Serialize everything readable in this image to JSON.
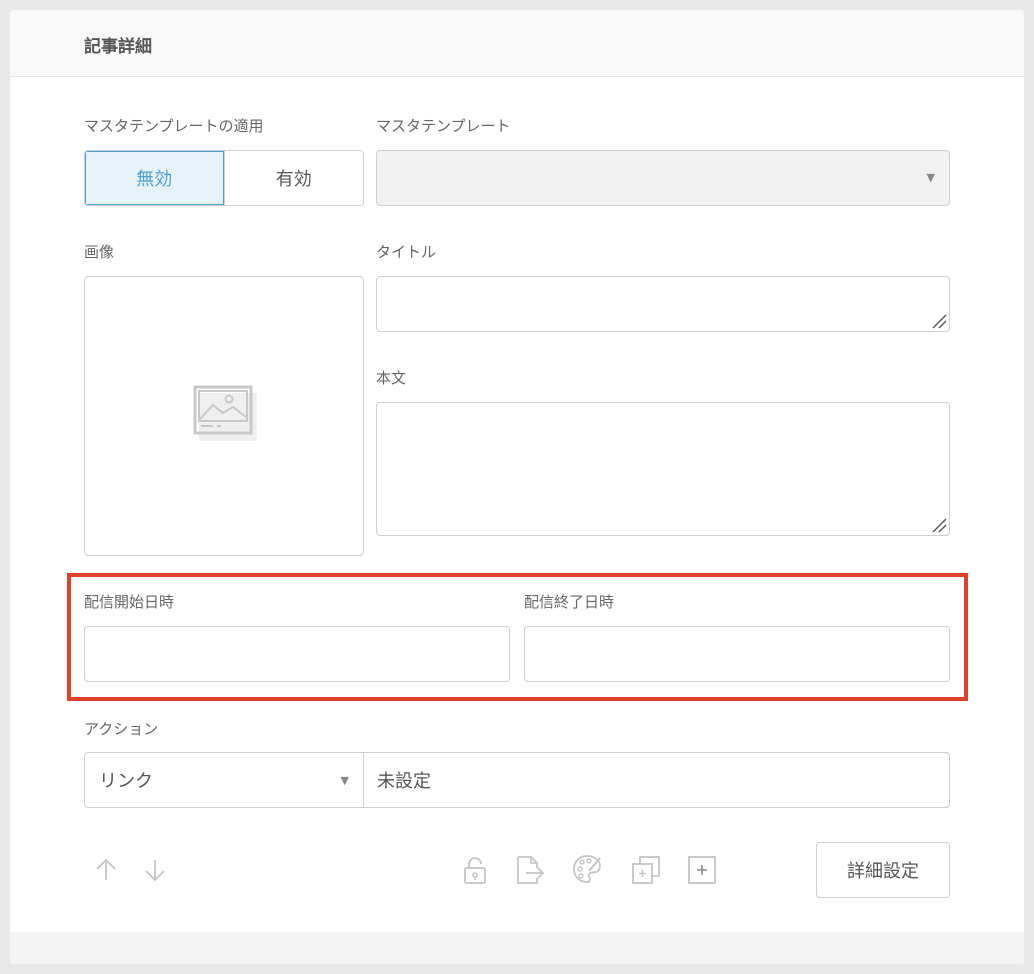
{
  "panel": {
    "title": "記事詳細"
  },
  "master_template": {
    "apply_label": "マスタテンプレートの適用",
    "options": [
      "無効",
      "有効"
    ],
    "selected": "無効",
    "template_label": "マスタテンプレート",
    "template_value": ""
  },
  "image": {
    "label": "画像",
    "icon": "image-placeholder-icon"
  },
  "title_field": {
    "label": "タイトル",
    "value": ""
  },
  "body_field": {
    "label": "本文",
    "value": ""
  },
  "schedule": {
    "start_label": "配信開始日時",
    "start_value": "",
    "end_label": "配信終了日時",
    "end_value": "",
    "highlight_color": "#e0412b"
  },
  "action": {
    "label": "アクション",
    "type": "リンク",
    "value": "未設定"
  },
  "toolbar": {
    "icons": [
      "arrow-up-icon",
      "arrow-down-icon",
      "lock-icon",
      "export-icon",
      "palette-icon",
      "duplicate-icon",
      "add-icon"
    ],
    "detail_button": "詳細設定"
  },
  "colors": {
    "accent": "#4fa0d1",
    "active_bg": "#e6f1f8"
  }
}
